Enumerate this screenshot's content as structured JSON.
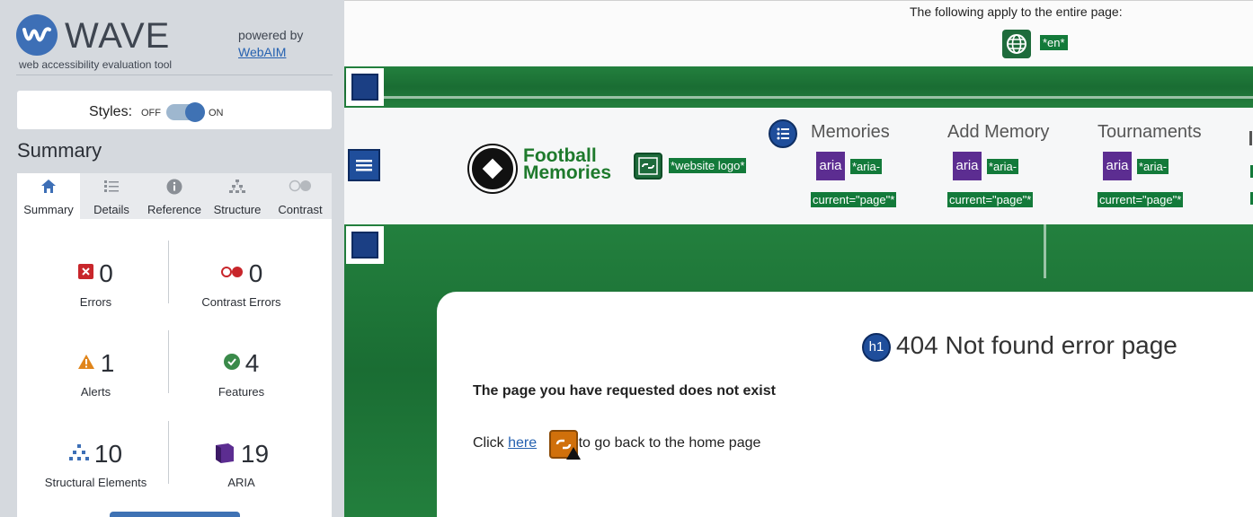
{
  "sidebar": {
    "logo_title": "WAVE",
    "logo_subtitle": "web accessibility evaluation tool",
    "powered_by": "powered by",
    "webaim_link": "WebAIM",
    "styles": {
      "label": "Styles:",
      "off": "OFF",
      "on": "ON",
      "state": "on"
    },
    "summary_heading": "Summary",
    "tabs": [
      {
        "label": "Summary",
        "icon": "home-icon",
        "active": true
      },
      {
        "label": "Details",
        "icon": "list-icon",
        "active": false
      },
      {
        "label": "Reference",
        "icon": "info-icon",
        "active": false
      },
      {
        "label": "Structure",
        "icon": "hierarchy-icon",
        "active": false
      },
      {
        "label": "Contrast",
        "icon": "contrast-icon",
        "active": false
      }
    ],
    "counts": {
      "errors": {
        "value": "0",
        "label": "Errors",
        "color": "#c8262b"
      },
      "contrast_errors": {
        "value": "0",
        "label": "Contrast Errors",
        "color": "#c8262b"
      },
      "alerts": {
        "value": "1",
        "label": "Alerts",
        "color": "#e0851b"
      },
      "features": {
        "value": "4",
        "label": "Features",
        "color": "#3a8a4a"
      },
      "structural": {
        "value": "10",
        "label": "Structural Elements",
        "color": "#3d6fb6"
      },
      "aria": {
        "value": "19",
        "label": "ARIA",
        "color": "#5c2d91"
      }
    }
  },
  "preview": {
    "applies_text": "The following apply to the entire page:",
    "lang_tag": "*en*",
    "logo_text_line1": "Football",
    "logo_text_line2": "Memories",
    "logo_alt_tag": "*website logo*",
    "nav_items": [
      {
        "label": "Memories",
        "aria_tag_1": "*aria-",
        "aria_tag_2": "current=\"page\"*"
      },
      {
        "label": "Add Memory",
        "aria_tag_1": "*aria-",
        "aria_tag_2": "current=\"page\"*"
      },
      {
        "label": "Tournaments",
        "aria_tag_1": "*aria-",
        "aria_tag_2": "current=\"page\"*"
      }
    ],
    "aria_icon_text": "aria",
    "h1_icon_text": "h1",
    "heading": "404 Not found error page",
    "message": "The page you have requested does not exist",
    "click_before": "Click ",
    "click_link": "here",
    "click_after": " to go back to the home page"
  },
  "colors": {
    "accent": "#3d6fb6",
    "grass": "#23803e",
    "aria": "#5c2d91",
    "alert": "#d0700b"
  }
}
